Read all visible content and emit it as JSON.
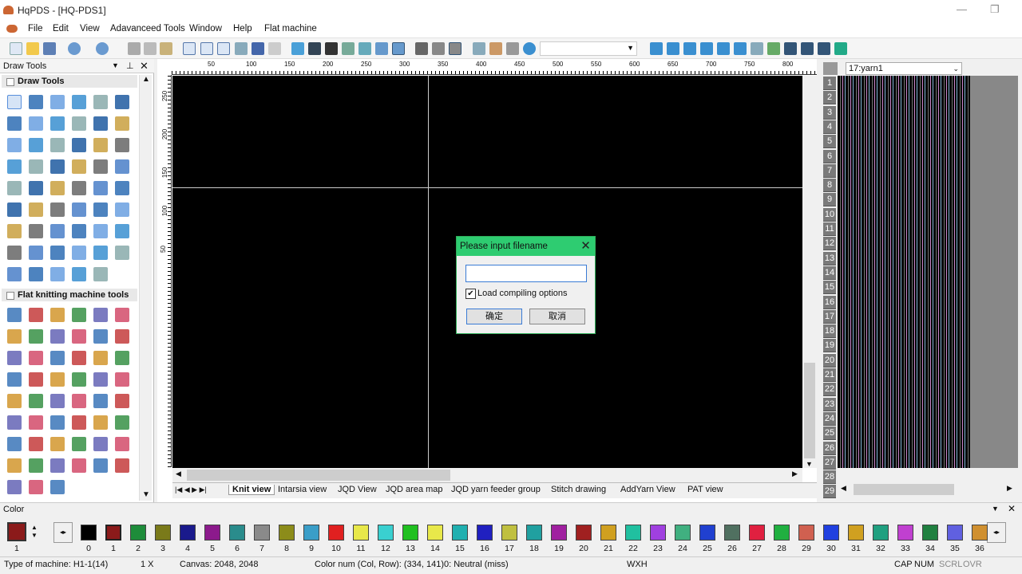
{
  "title": "HqPDS - [HQ-PDS1]",
  "menu": [
    "File",
    "Edit",
    "View",
    "Adavanceed Tools",
    "Window",
    "Help",
    "Flat machine"
  ],
  "left_panel": {
    "title": "Draw Tools",
    "section1": "Draw Tools",
    "section2": "Flat knitting machine tools"
  },
  "ruler_top": [
    "50",
    "100",
    "150",
    "200",
    "250",
    "300",
    "350",
    "400",
    "450",
    "500",
    "550",
    "600",
    "650",
    "700",
    "750",
    "800"
  ],
  "ruler_left": [
    "250",
    "200",
    "150",
    "100",
    "50"
  ],
  "tabs": [
    "Knit view",
    "Intarsia view",
    "JQD View",
    "JQD area map",
    "JQD yarn feeder group",
    "Stitch drawing",
    "AddYarn View",
    "PAT view"
  ],
  "right_panel": {
    "yarn_select": "17:yarn1",
    "rows": [
      "1",
      "2",
      "3",
      "4",
      "5",
      "6",
      "7",
      "8",
      "9",
      "10",
      "11",
      "12",
      "13",
      "14",
      "15",
      "16",
      "17",
      "18",
      "19",
      "20",
      "21",
      "22",
      "23",
      "24",
      "25",
      "26",
      "27",
      "28",
      "29"
    ]
  },
  "color_bar": {
    "title": "Color",
    "current_label": "1",
    "numbers": [
      "0",
      "1",
      "2",
      "3",
      "4",
      "5",
      "6",
      "7",
      "8",
      "9",
      "10",
      "11",
      "12",
      "13",
      "14",
      "15",
      "16",
      "17",
      "18",
      "19",
      "20",
      "21",
      "22",
      "23",
      "24",
      "25",
      "26",
      "27",
      "28",
      "29",
      "30",
      "31",
      "32",
      "33",
      "34",
      "35",
      "36"
    ],
    "colors": [
      "#000000",
      "#8b1a1a",
      "#1e8c3a",
      "#7a7a1a",
      "#1a1a8c",
      "#8c1a8c",
      "#2a8c8c",
      "#8a8a8a",
      "#8c8c1a",
      "#3a9ec8",
      "#e02020",
      "#e8e84a",
      "#3ad0d0",
      "#20c020",
      "#e8e84a",
      "#20b0b0",
      "#2020c0",
      "#c0c040",
      "#20a0a0",
      "#a020a0",
      "#a02020",
      "#d0a020",
      "#20c0a0",
      "#a040e0",
      "#40b080",
      "#2040d0",
      "#507060",
      "#e02040",
      "#20b040",
      "#d06050",
      "#2040e0",
      "#d0a020",
      "#20a080",
      "#c040d0",
      "#208040",
      "#6060e0",
      "#d09030"
    ]
  },
  "dialog": {
    "title": "Please input filename",
    "input_value": "",
    "checkbox_label": "Load compiling options",
    "checked": true,
    "ok": "确定",
    "cancel": "取消"
  },
  "status": {
    "machine": "Type of machine: H1-1(14)",
    "zoom": "1 X",
    "canvas": "Canvas: 2048, 2048",
    "colornum": "Color num  (Col, Row): (334, 141)0: Neutral (miss)",
    "wxh": "WXH",
    "cap": "CAP",
    "num": "NUM",
    "scrl": "SCRL",
    "ovr": "OVR"
  }
}
